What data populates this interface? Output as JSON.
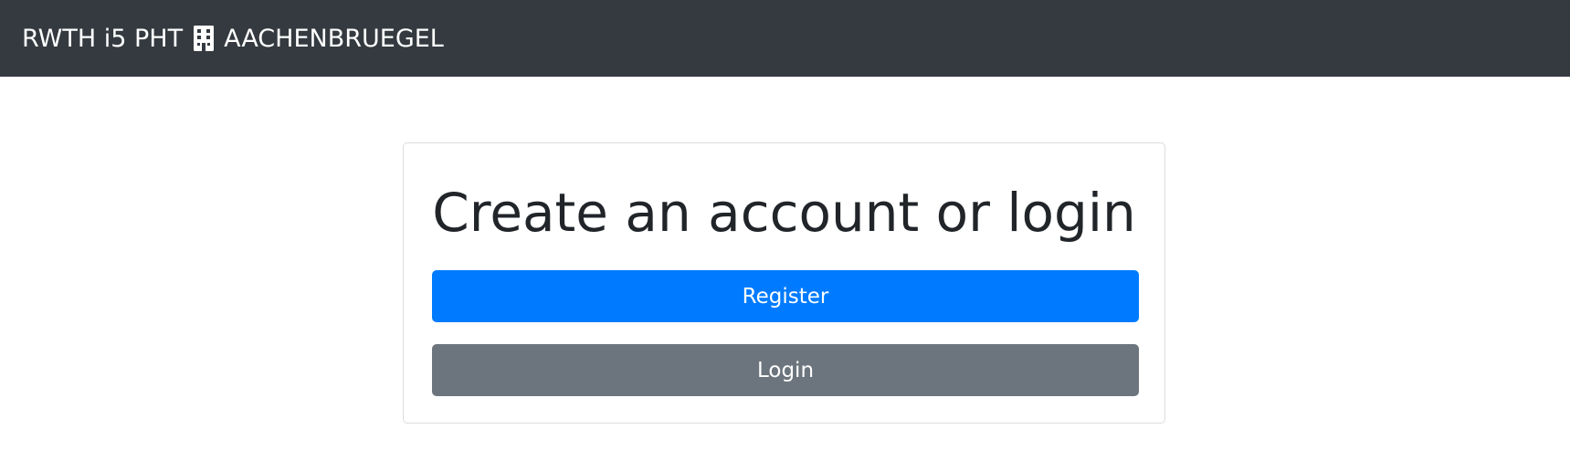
{
  "navbar": {
    "brand_prefix": "RWTH i5 PHT",
    "brand_icon": "building-icon",
    "brand_suffix": "AACHENBRUEGEL",
    "background": "#343a40"
  },
  "card": {
    "title": "Create an account or login",
    "register_label": "Register",
    "login_label": "Login",
    "register_color": "#007bff",
    "login_color": "#6c757d"
  }
}
